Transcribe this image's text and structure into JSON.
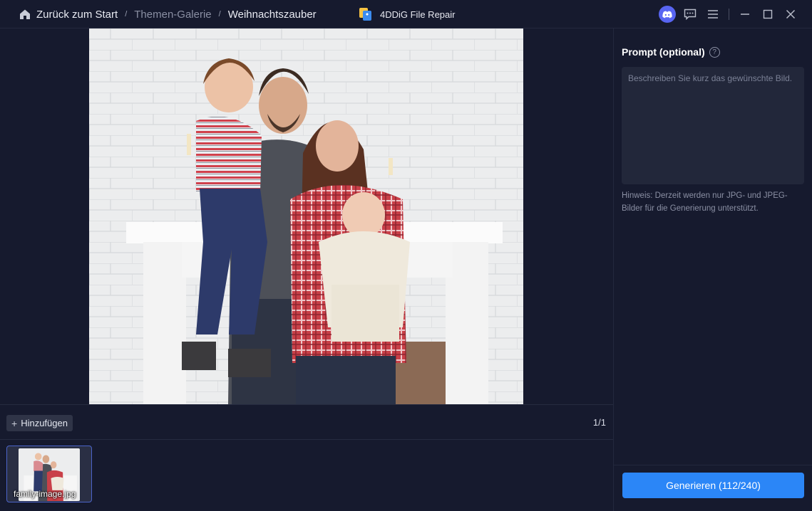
{
  "titlebar": {
    "breadcrumbs": [
      {
        "label": "Zurück zum Start",
        "icon": "home-icon"
      },
      {
        "label": "Themen-Galerie"
      },
      {
        "label": "Weihnachtszauber"
      }
    ],
    "separator": "/",
    "app_name": "4DDiG File Repair",
    "controls": [
      "discord-icon",
      "feedback-icon",
      "menu-icon",
      "minimize-icon",
      "maximize-icon",
      "close-icon"
    ]
  },
  "canvas": {
    "image_alt": "family-image.jpg"
  },
  "toolbar": {
    "add_label": "Hinzufügen",
    "page_count": "1/1"
  },
  "thumbnails": [
    {
      "filename": "family-image.jpg",
      "selected": true
    }
  ],
  "panel": {
    "prompt_title": "Prompt (optional)",
    "prompt_placeholder": "Beschreiben Sie kurz das gewünschte Bild.",
    "prompt_value": "",
    "hint": "Hinweis: Derzeit werden nur JPG- und JPEG-Bilder für die Generierung unterstützt.",
    "generate_label": "Generieren (112/240)"
  },
  "colors": {
    "background": "#161a2e",
    "accent": "#2b86f7",
    "input_bg": "#22273a",
    "discord": "#5865f2"
  }
}
